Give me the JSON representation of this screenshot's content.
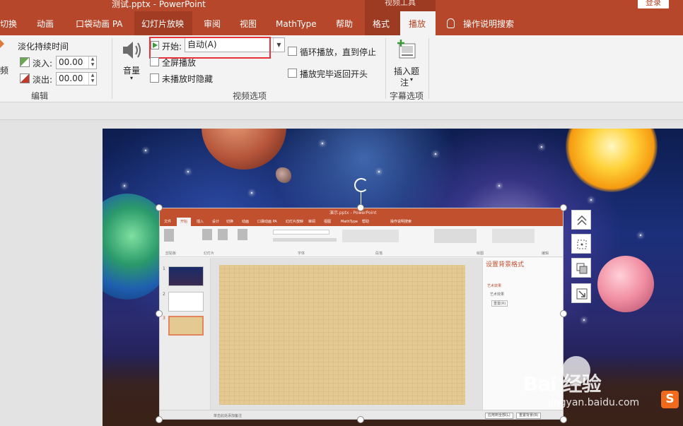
{
  "titlebar": {
    "doc_title": "测试.pptx  -  PowerPoint",
    "context_label": "视频工具",
    "signin_label": "登录"
  },
  "tabs": [
    {
      "label": "切换"
    },
    {
      "label": "动画"
    },
    {
      "label": "口袋动画 PA"
    },
    {
      "label": "幻灯片放映"
    },
    {
      "label": "审阅"
    },
    {
      "label": "视图"
    },
    {
      "label": "MathType"
    },
    {
      "label": "帮助"
    },
    {
      "label": "格式"
    },
    {
      "label": "播放"
    },
    {
      "label": "操作说明搜索"
    }
  ],
  "ribbon": {
    "edit": {
      "partial_label": "频",
      "fade_duration_label": "淡化持续时间",
      "fade_in_label": "淡入:",
      "fade_in_value": "00.00",
      "fade_out_label": "淡出:",
      "fade_out_value": "00.00",
      "group_label": "编辑"
    },
    "video_options": {
      "volume_label": "音量",
      "start_label": "开始:",
      "start_value": "自动(A)",
      "fullscreen_label": "全屏播放",
      "hide_label": "未播放时隐藏",
      "loop_label": "循环播放，直到停止",
      "rewind_label": "播放完毕返回开头",
      "group_label": "视频选项"
    },
    "captions": {
      "insert_label_1": "插入题",
      "insert_label_2": "注",
      "group_label": "字幕选项"
    }
  },
  "video_frame": {
    "title": "演示.pptx - PowerPoint",
    "tabs": [
      "文件",
      "开始",
      "插入",
      "设计",
      "切换",
      "动画",
      "口袋动画 PA",
      "幻灯片放映",
      "审阅",
      "视图",
      "MathType",
      "帮助",
      "操作说明搜索"
    ],
    "active_tab": "开始",
    "groups": [
      "剪贴板",
      "幻灯片",
      "字体",
      "段落",
      "绘图",
      "编辑"
    ],
    "slide_numbers": [
      "1",
      "2",
      "3"
    ],
    "pane_title": "设置背景格式",
    "pane_items": [
      "艺术效果",
      "艺术效果"
    ],
    "pane_reset": "重置(R)",
    "status_note": "单击此处添加备注",
    "apply_all": "应用到全部(L)",
    "reset_bg": "重置背景(B)"
  },
  "watermark": {
    "brand": "Bai 经验",
    "url": "jingyan.baidu.com",
    "ime_logo": "S"
  },
  "colors": {
    "accent": "#b7472a",
    "highlight_box": "#e8323a"
  }
}
